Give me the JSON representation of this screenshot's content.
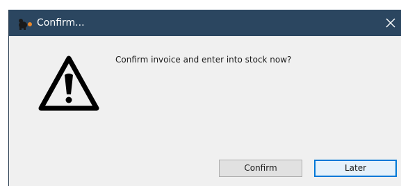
{
  "window": {
    "title": "Confirm...",
    "app_icon": "mobile-supply-app-icon",
    "close_icon": "close-icon",
    "close_glyph": "✕"
  },
  "dialog": {
    "icon": "warning-icon",
    "message": "Confirm invoice and enter into stock now?"
  },
  "buttons": {
    "confirm_label": "Confirm",
    "later_label": "Later"
  },
  "colors": {
    "titlebar": "#2b4660",
    "body": "#f0f0f0",
    "default_button_border": "#0078d7"
  }
}
